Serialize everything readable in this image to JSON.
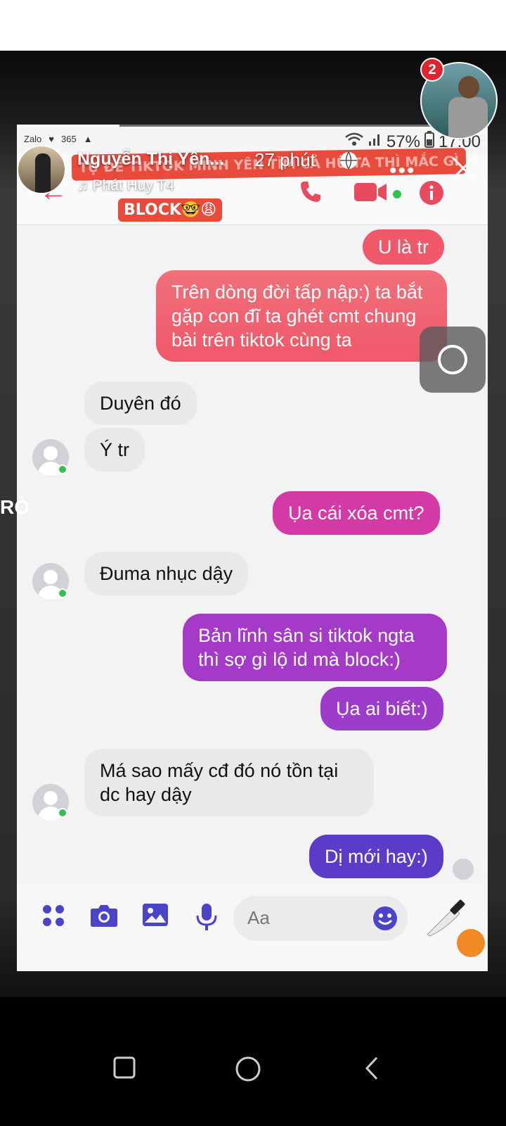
{
  "status": {
    "battery": "57%",
    "time": "17:00",
    "left_labels": [
      "Zalo",
      "365"
    ]
  },
  "story": {
    "author": "Nguyễn Thị Yến...",
    "time": "27 phút",
    "music": "Phát Huy T4",
    "more": "•••",
    "overlay_line1": "TỰ ĐỂ TIKTOK MÌNH YÊN TÌM CẢ HỮ TA THÌ MẮC GÌ",
    "overlay_line2": "BLOCK🤓😩",
    "notification_count": "2",
    "side_text": "RÒ"
  },
  "chat": {
    "messages": [
      {
        "dir": "out",
        "text": "U là tr",
        "color": "#f0596a"
      },
      {
        "dir": "out",
        "text": "Trên dòng đời tấp nập:) ta bắt gặp con đĩ ta ghét cmt chung bài trên tiktok cùng ta",
        "color": "#f06169"
      },
      {
        "dir": "in",
        "text": "Duyên đó"
      },
      {
        "dir": "in",
        "text": "Ý tr"
      },
      {
        "dir": "out",
        "text": "Ụa cái xóa cmt?",
        "color": "#d43aa6"
      },
      {
        "dir": "in",
        "text": "Đuma nhục dậy"
      },
      {
        "dir": "out",
        "text": "Bản lĩnh sân si tiktok ngta thì sợ gì lộ id mà block:)",
        "color": "#a53ac8"
      },
      {
        "dir": "out",
        "text": "Ụa ai biết:)",
        "color": "#9d3bca"
      },
      {
        "dir": "in",
        "text": "Má sao mấy cđ đó nó tồn tại dc hay dậy"
      },
      {
        "dir": "out",
        "text": "Dị mới hay:)",
        "color": "#5a3cc8"
      }
    ],
    "input_placeholder": "Aa"
  },
  "icons": {
    "header": [
      "back-arrow-icon",
      "phone-icon",
      "video-camera-icon",
      "info-icon"
    ],
    "input": [
      "apps-icon",
      "camera-icon",
      "image-icon",
      "microphone-icon",
      "emoji-icon"
    ],
    "nav": [
      "recent-apps-icon",
      "home-icon",
      "back-icon"
    ]
  },
  "colors": {
    "accent": "#e84a5f",
    "input_icons": "#4b44c8"
  }
}
